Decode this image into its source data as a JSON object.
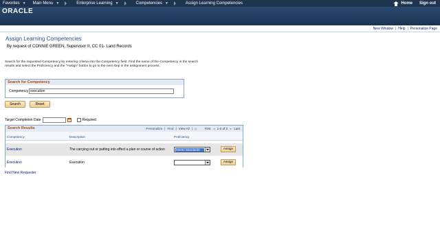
{
  "nav": {
    "items": [
      {
        "label": "Favorites"
      },
      {
        "label": "Main Menu"
      },
      {
        "label": "Enterprise Learning"
      },
      {
        "label": "Competencies"
      },
      {
        "label": "Assign Learning Competencies"
      }
    ],
    "home": "Home",
    "signout": "Sign out"
  },
  "brand": {
    "logo": "ORACLE"
  },
  "toplinks": {
    "new_window": "New Window",
    "help": "Help",
    "personalize": "Personalize Page"
  },
  "page": {
    "title": "Assign Learning Competencies",
    "subtitle": "By request of CONNIE GREEN, Supervisor II, CC 01- Land Records",
    "instructions": "Search for the requested Competency by entering criteria into the Competency field. Find the name of the Competency in the search results and select the Proficiency and the \"Assign\" button to go to the next step in the assignment process."
  },
  "search": {
    "header": "Search for Competency",
    "label": "Competency",
    "value": "execution",
    "search_btn": "Search",
    "reset_btn": "Reset"
  },
  "target": {
    "label": "Target Completion Date",
    "value": "",
    "required_label": "Required"
  },
  "results": {
    "header": "Search Results",
    "personalize": "Personalize",
    "find": "Find",
    "view_all": "View All",
    "first": "First",
    "range": "1-2 of 2",
    "last": "Last",
    "columns": [
      "Competency",
      "Description",
      "Proficiency"
    ],
    "rows": [
      {
        "competency": "Execution",
        "description": "The carrying out or putting into effect a plan or course of action",
        "proficiency": "Meets Standards",
        "assign": "Assign"
      },
      {
        "competency": "Execution",
        "description": "Execution",
        "proficiency": "",
        "assign": "Assign"
      }
    ]
  },
  "footer": {
    "new_requester": "Find New Requester"
  }
}
